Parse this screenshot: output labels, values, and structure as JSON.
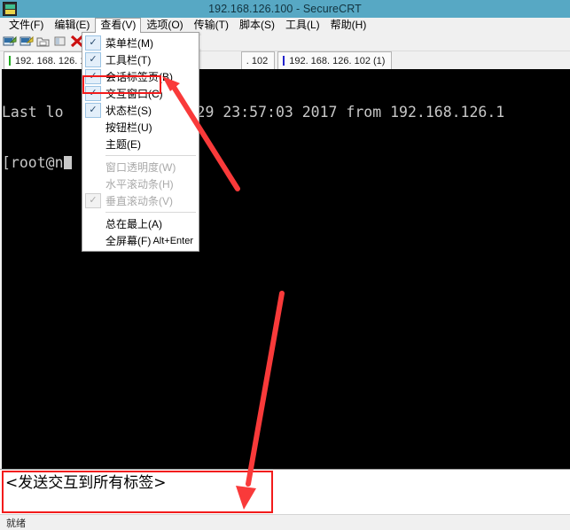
{
  "window": {
    "title": "192.168.126.100 - SecureCRT",
    "app_icon": "securecrt-icon"
  },
  "menubar": {
    "items": [
      {
        "label": "文件(F)",
        "active": false
      },
      {
        "label": "编辑(E)",
        "active": false
      },
      {
        "label": "查看(V)",
        "active": true
      },
      {
        "label": "选项(O)",
        "active": false
      },
      {
        "label": "传输(T)",
        "active": false
      },
      {
        "label": "脚本(S)",
        "active": false
      },
      {
        "label": "工具(L)",
        "active": false
      },
      {
        "label": "帮助(H)",
        "active": false
      }
    ]
  },
  "toolbar": {
    "icons": [
      "new-session-icon",
      "clone-session-icon",
      "connect-folder-icon",
      "connect-sftp-icon",
      "disconnect-icon",
      "print-icon",
      "log-session-icon",
      "key-icon",
      "help-icon",
      "properties-icon"
    ]
  },
  "tabs": [
    {
      "label": "192. 168. 126. 100",
      "dot_color": "#22aa22",
      "active": true
    },
    {
      "label": ". 102",
      "dot_color": "#2222cc",
      "active": false
    },
    {
      "label": "192. 168. 126. 102 (1)",
      "dot_color": "#2222cc",
      "active": false
    }
  ],
  "dropdown": {
    "menu_owner": "查看(V)",
    "items": [
      {
        "label": "菜单栏(M)",
        "checked": true,
        "disabled": false,
        "accel": ""
      },
      {
        "label": "工具栏(T)",
        "checked": true,
        "disabled": false,
        "accel": ""
      },
      {
        "label": "会话标签页(B)",
        "checked": true,
        "disabled": false,
        "accel": ""
      },
      {
        "label": "交互窗口(C)",
        "checked": true,
        "disabled": false,
        "accel": ""
      },
      {
        "label": "状态栏(S)",
        "checked": true,
        "disabled": false,
        "accel": ""
      },
      {
        "label": "按钮栏(U)",
        "checked": false,
        "disabled": false,
        "accel": ""
      },
      {
        "label": "主题(E)",
        "checked": false,
        "disabled": false,
        "accel": ""
      },
      {
        "label": "窗口透明度(W)",
        "checked": false,
        "disabled": true,
        "accel": ""
      },
      {
        "label": "水平滚动条(H)",
        "checked": false,
        "disabled": true,
        "accel": ""
      },
      {
        "label": "垂直滚动条(V)",
        "checked": true,
        "disabled": true,
        "accel": ""
      },
      {
        "label": "总在最上(A)",
        "checked": false,
        "disabled": false,
        "accel": ""
      },
      {
        "label": "全屏幕(F)",
        "checked": false,
        "disabled": false,
        "accel": "Alt+Enter"
      }
    ],
    "highlighted_item": "交互窗口(C)"
  },
  "terminal": {
    "line1_left": "Last lo",
    "line1_right": "29 23:57:03 2017 from 192.168.126.1",
    "line2_left": "[root@n",
    "background": "#000000",
    "foreground": "#c8c8c8"
  },
  "chat_panel": {
    "text": "<发送交互到所有标签>"
  },
  "statusbar": {
    "text": "就绪"
  },
  "annotations": {
    "accent_color": "#f21b1b",
    "box1_label": "highlight-menu-item-interactive-window",
    "box2_label": "highlight-chat-send-panel",
    "arrow1_label": "arrow-to-menu-item",
    "arrow2_label": "arrow-to-chat-panel"
  }
}
